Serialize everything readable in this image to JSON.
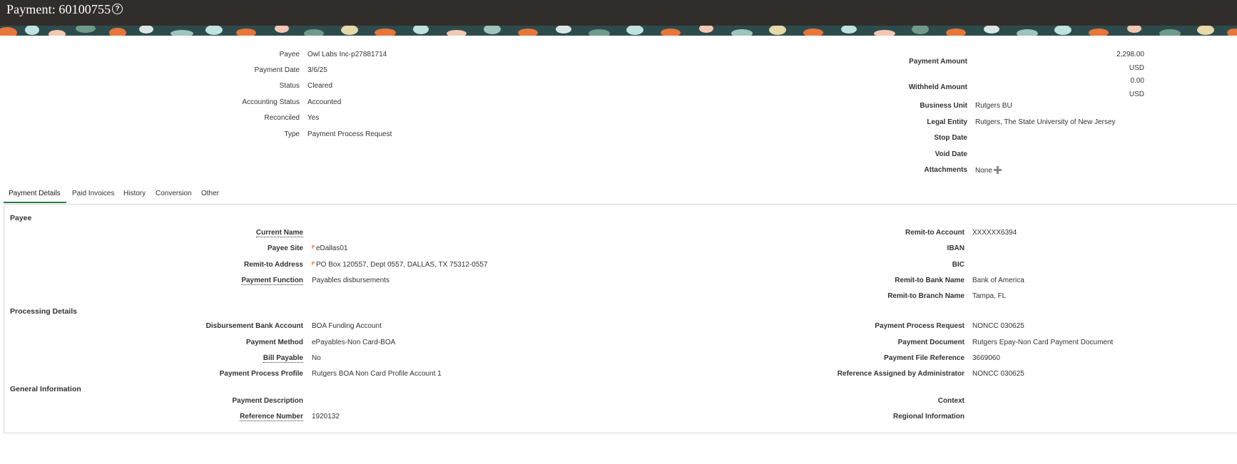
{
  "header": {
    "title": "Payment: 60100755",
    "help_glyph": "?"
  },
  "summary": {
    "left": [
      {
        "label": "Payee",
        "value": "Owl Labs Inc-p27881714"
      },
      {
        "label": "Payment Date",
        "value": "3/6/25"
      },
      {
        "label": "Status",
        "value": "Cleared"
      },
      {
        "label": "Accounting Status",
        "value": "Accounted"
      },
      {
        "label": "Reconciled",
        "value": "Yes"
      },
      {
        "label": "Type",
        "value": "Payment Process Request"
      }
    ],
    "payment_amount": {
      "label": "Payment Amount",
      "value": "2,298.00",
      "currency": "USD"
    },
    "withheld_amount": {
      "label": "Withheld Amount",
      "value": "0.00",
      "currency": "USD"
    },
    "right": [
      {
        "label": "Business Unit",
        "value": "Rutgers BU"
      },
      {
        "label": "Legal Entity",
        "value": "Rutgers, The State University of New Jersey"
      },
      {
        "label": "Stop Date",
        "value": ""
      },
      {
        "label": "Void Date",
        "value": ""
      }
    ],
    "attachments": {
      "label": "Attachments",
      "value": "None"
    }
  },
  "tabs": [
    {
      "label": "Payment Details",
      "active": true
    },
    {
      "label": "Paid Invoices"
    },
    {
      "label": "History"
    },
    {
      "label": "Conversion"
    },
    {
      "label": "Other"
    }
  ],
  "payee_section": {
    "title": "Payee",
    "left": [
      {
        "label": "Current Name",
        "value": ""
      },
      {
        "label": "Payee Site",
        "value": "eDallas01"
      },
      {
        "label": "Remit-to Address",
        "value": "PO Box 120557, Dept 0557, DALLAS, TX 75312-0557"
      },
      {
        "label": "Payment Function",
        "value": "Payables disbursements"
      }
    ],
    "right": [
      {
        "label": "Remit-to Account",
        "value": "XXXXXX6394"
      },
      {
        "label": "IBAN",
        "value": ""
      },
      {
        "label": "BIC",
        "value": ""
      },
      {
        "label": "Remit-to Bank Name",
        "value": "Bank of America"
      },
      {
        "label": "Remit-to Branch Name",
        "value": "Tampa, FL"
      }
    ]
  },
  "processing_section": {
    "title": "Processing Details",
    "left": [
      {
        "label": "Disbursement Bank Account",
        "value": "BOA Funding Account"
      },
      {
        "label": "Payment Method",
        "value": "ePayables-Non Card-BOA"
      },
      {
        "label": "Bill Payable",
        "value": "No"
      },
      {
        "label": "Payment Process Profile",
        "value": "Rutgers BOA Non Card Profile Account 1"
      }
    ],
    "right": [
      {
        "label": "Payment Process Request",
        "value": "NONCC 030625"
      },
      {
        "label": "Payment Document",
        "value": "Rutgers Epay-Non Card Payment Document"
      },
      {
        "label": "Payment File Reference",
        "value": "3669060"
      },
      {
        "label": "Reference Assigned by Administrator",
        "value": "NONCC 030625"
      }
    ]
  },
  "general_section": {
    "title": "General Information",
    "left": [
      {
        "label": "Payment Description",
        "value": ""
      },
      {
        "label": "Reference Number",
        "value": "1920132"
      }
    ],
    "right": [
      {
        "label": "Context",
        "value": ""
      },
      {
        "label": "Regional Information",
        "value": ""
      }
    ]
  },
  "colors": {
    "titlebar": "#312d2a",
    "tab_accent": "#257c4a",
    "flag": "#f0a070"
  },
  "icons": {
    "help": "help-circle-icon",
    "add_attachment": "plus-icon",
    "changed_value": "flag-icon"
  }
}
